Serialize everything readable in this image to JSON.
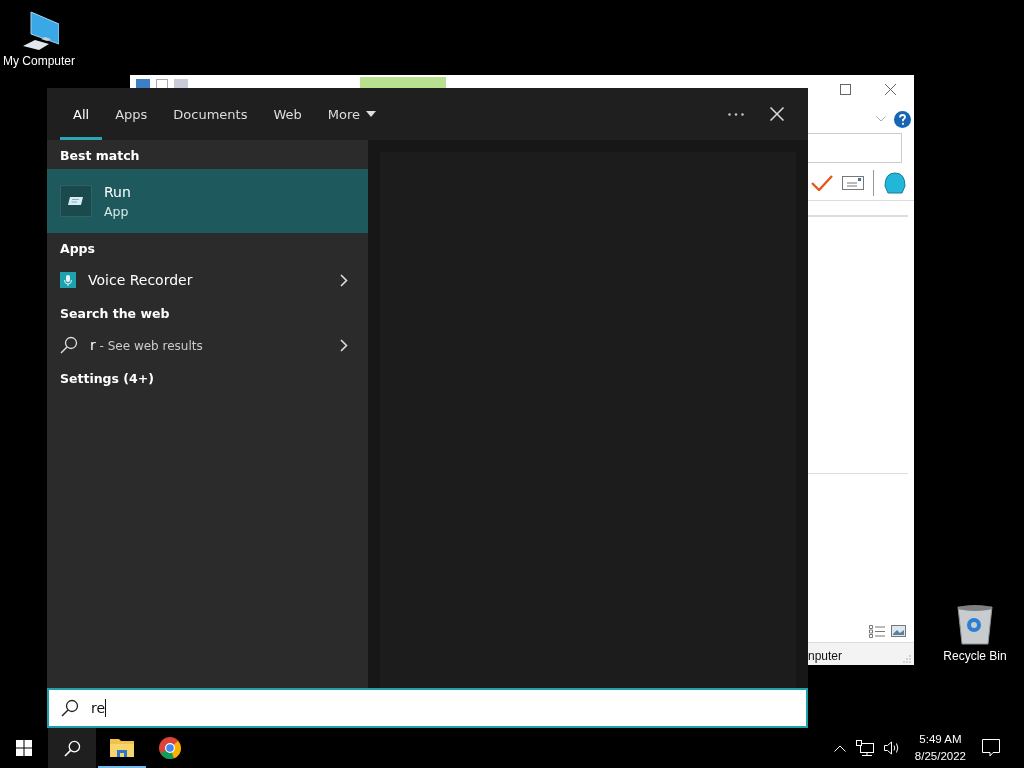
{
  "desktop_icons": [
    {
      "kind": "computer",
      "label": "My Computer"
    },
    {
      "kind": "recycle",
      "label": "Recycle Bin"
    }
  ],
  "background_window": {
    "status_text": "nputer"
  },
  "search": {
    "tabs": [
      {
        "label": "All",
        "selected": true,
        "dropdown": false
      },
      {
        "label": "Apps",
        "selected": false,
        "dropdown": false
      },
      {
        "label": "Documents",
        "selected": false,
        "dropdown": false
      },
      {
        "label": "Web",
        "selected": false,
        "dropdown": false
      },
      {
        "label": "More",
        "selected": false,
        "dropdown": true
      }
    ],
    "best_match": {
      "heading": "Best match",
      "title": "Run",
      "subtitle": "App"
    },
    "sections": [
      {
        "heading": "Apps",
        "items": [
          {
            "kind": "app",
            "label": "Voice Recorder"
          }
        ]
      },
      {
        "heading": "Search the web",
        "items": [
          {
            "kind": "web",
            "query": "r",
            "label": "- See web results"
          }
        ]
      },
      {
        "heading": "Settings (4+)"
      }
    ],
    "query": "re"
  },
  "taskbar": {
    "time": "5:49 AM",
    "date": "8/25/2022"
  }
}
